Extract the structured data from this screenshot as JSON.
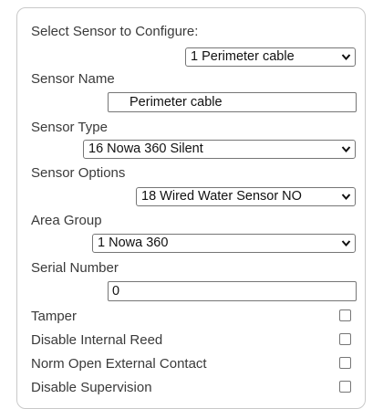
{
  "form": {
    "select_sensor": {
      "label": "Select Sensor to Configure:",
      "value": "1 Perimeter cable"
    },
    "sensor_name": {
      "label": "Sensor Name",
      "value": "Perimeter cable"
    },
    "sensor_type": {
      "label": "Sensor Type",
      "value": "16 Nowa 360 Silent"
    },
    "sensor_options": {
      "label": "Sensor Options",
      "value": "18 Wired Water Sensor NO"
    },
    "area_group": {
      "label": "Area Group",
      "value": "1 Nowa 360"
    },
    "serial_number": {
      "label": "Serial Number",
      "value": "0"
    },
    "checkboxes": [
      {
        "label": "Tamper",
        "checked": false
      },
      {
        "label": "Disable Internal Reed",
        "checked": false
      },
      {
        "label": "Norm Open External Contact",
        "checked": false
      },
      {
        "label": "Disable Supervision",
        "checked": false
      }
    ]
  },
  "icons": {
    "dropdown": "chevron-down-icon"
  }
}
